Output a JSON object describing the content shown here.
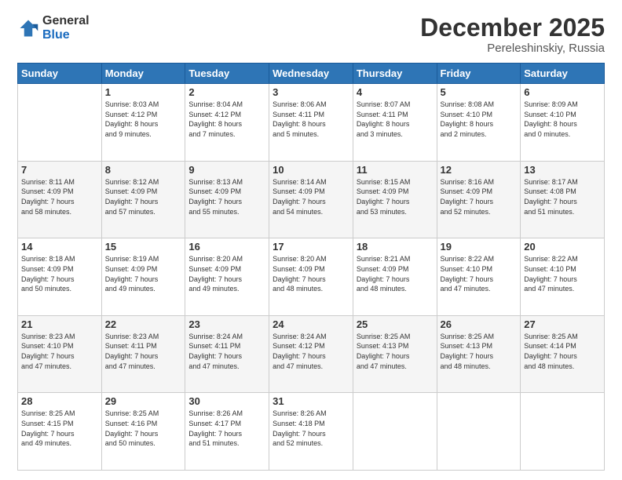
{
  "logo": {
    "general": "General",
    "blue": "Blue"
  },
  "title": "December 2025",
  "subtitle": "Pereleshinskiy, Russia",
  "headers": [
    "Sunday",
    "Monday",
    "Tuesday",
    "Wednesday",
    "Thursday",
    "Friday",
    "Saturday"
  ],
  "weeks": [
    [
      {
        "day": "",
        "info": ""
      },
      {
        "day": "1",
        "info": "Sunrise: 8:03 AM\nSunset: 4:12 PM\nDaylight: 8 hours\nand 9 minutes."
      },
      {
        "day": "2",
        "info": "Sunrise: 8:04 AM\nSunset: 4:12 PM\nDaylight: 8 hours\nand 7 minutes."
      },
      {
        "day": "3",
        "info": "Sunrise: 8:06 AM\nSunset: 4:11 PM\nDaylight: 8 hours\nand 5 minutes."
      },
      {
        "day": "4",
        "info": "Sunrise: 8:07 AM\nSunset: 4:11 PM\nDaylight: 8 hours\nand 3 minutes."
      },
      {
        "day": "5",
        "info": "Sunrise: 8:08 AM\nSunset: 4:10 PM\nDaylight: 8 hours\nand 2 minutes."
      },
      {
        "day": "6",
        "info": "Sunrise: 8:09 AM\nSunset: 4:10 PM\nDaylight: 8 hours\nand 0 minutes."
      }
    ],
    [
      {
        "day": "7",
        "info": "Sunrise: 8:11 AM\nSunset: 4:09 PM\nDaylight: 7 hours\nand 58 minutes."
      },
      {
        "day": "8",
        "info": "Sunrise: 8:12 AM\nSunset: 4:09 PM\nDaylight: 7 hours\nand 57 minutes."
      },
      {
        "day": "9",
        "info": "Sunrise: 8:13 AM\nSunset: 4:09 PM\nDaylight: 7 hours\nand 55 minutes."
      },
      {
        "day": "10",
        "info": "Sunrise: 8:14 AM\nSunset: 4:09 PM\nDaylight: 7 hours\nand 54 minutes."
      },
      {
        "day": "11",
        "info": "Sunrise: 8:15 AM\nSunset: 4:09 PM\nDaylight: 7 hours\nand 53 minutes."
      },
      {
        "day": "12",
        "info": "Sunrise: 8:16 AM\nSunset: 4:09 PM\nDaylight: 7 hours\nand 52 minutes."
      },
      {
        "day": "13",
        "info": "Sunrise: 8:17 AM\nSunset: 4:08 PM\nDaylight: 7 hours\nand 51 minutes."
      }
    ],
    [
      {
        "day": "14",
        "info": "Sunrise: 8:18 AM\nSunset: 4:09 PM\nDaylight: 7 hours\nand 50 minutes."
      },
      {
        "day": "15",
        "info": "Sunrise: 8:19 AM\nSunset: 4:09 PM\nDaylight: 7 hours\nand 49 minutes."
      },
      {
        "day": "16",
        "info": "Sunrise: 8:20 AM\nSunset: 4:09 PM\nDaylight: 7 hours\nand 49 minutes."
      },
      {
        "day": "17",
        "info": "Sunrise: 8:20 AM\nSunset: 4:09 PM\nDaylight: 7 hours\nand 48 minutes."
      },
      {
        "day": "18",
        "info": "Sunrise: 8:21 AM\nSunset: 4:09 PM\nDaylight: 7 hours\nand 48 minutes."
      },
      {
        "day": "19",
        "info": "Sunrise: 8:22 AM\nSunset: 4:10 PM\nDaylight: 7 hours\nand 47 minutes."
      },
      {
        "day": "20",
        "info": "Sunrise: 8:22 AM\nSunset: 4:10 PM\nDaylight: 7 hours\nand 47 minutes."
      }
    ],
    [
      {
        "day": "21",
        "info": "Sunrise: 8:23 AM\nSunset: 4:10 PM\nDaylight: 7 hours\nand 47 minutes."
      },
      {
        "day": "22",
        "info": "Sunrise: 8:23 AM\nSunset: 4:11 PM\nDaylight: 7 hours\nand 47 minutes."
      },
      {
        "day": "23",
        "info": "Sunrise: 8:24 AM\nSunset: 4:11 PM\nDaylight: 7 hours\nand 47 minutes."
      },
      {
        "day": "24",
        "info": "Sunrise: 8:24 AM\nSunset: 4:12 PM\nDaylight: 7 hours\nand 47 minutes."
      },
      {
        "day": "25",
        "info": "Sunrise: 8:25 AM\nSunset: 4:13 PM\nDaylight: 7 hours\nand 47 minutes."
      },
      {
        "day": "26",
        "info": "Sunrise: 8:25 AM\nSunset: 4:13 PM\nDaylight: 7 hours\nand 48 minutes."
      },
      {
        "day": "27",
        "info": "Sunrise: 8:25 AM\nSunset: 4:14 PM\nDaylight: 7 hours\nand 48 minutes."
      }
    ],
    [
      {
        "day": "28",
        "info": "Sunrise: 8:25 AM\nSunset: 4:15 PM\nDaylight: 7 hours\nand 49 minutes."
      },
      {
        "day": "29",
        "info": "Sunrise: 8:25 AM\nSunset: 4:16 PM\nDaylight: 7 hours\nand 50 minutes."
      },
      {
        "day": "30",
        "info": "Sunrise: 8:26 AM\nSunset: 4:17 PM\nDaylight: 7 hours\nand 51 minutes."
      },
      {
        "day": "31",
        "info": "Sunrise: 8:26 AM\nSunset: 4:18 PM\nDaylight: 7 hours\nand 52 minutes."
      },
      {
        "day": "",
        "info": ""
      },
      {
        "day": "",
        "info": ""
      },
      {
        "day": "",
        "info": ""
      }
    ]
  ]
}
